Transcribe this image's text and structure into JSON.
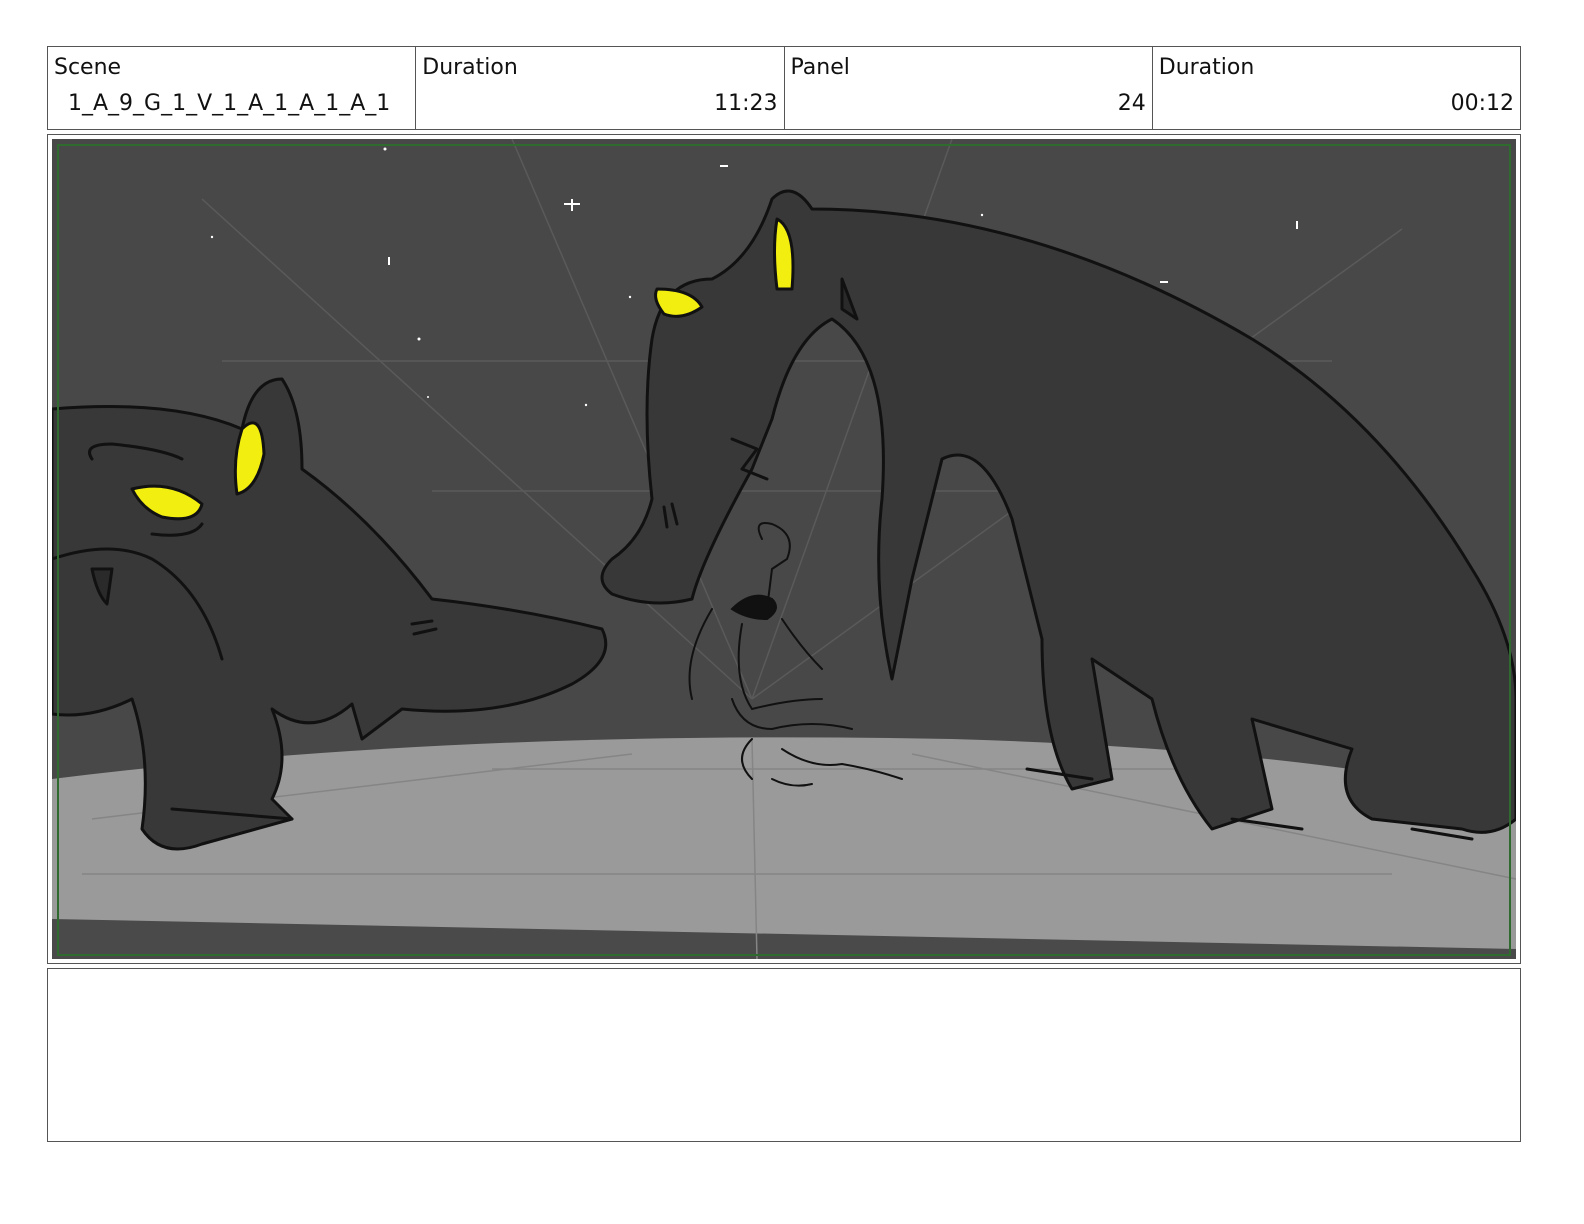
{
  "header": {
    "scene_label": "Scene",
    "scene_value": "1_A_9_G_1_V_1_A_1_A_1_A_1",
    "duration_label": "Duration",
    "duration_value": "11:23",
    "panel_label": "Panel",
    "panel_value": "24",
    "panel_duration_label": "Duration",
    "panel_duration_value": "00:12"
  },
  "panel": {
    "description": "",
    "colors": {
      "sky": "#484848",
      "ground": "#9a9a9a",
      "creature": "#3a3a3a",
      "eyes": "#f2ee10",
      "safe_frame": "#2f6b2f"
    }
  },
  "notes": {
    "text": ""
  }
}
